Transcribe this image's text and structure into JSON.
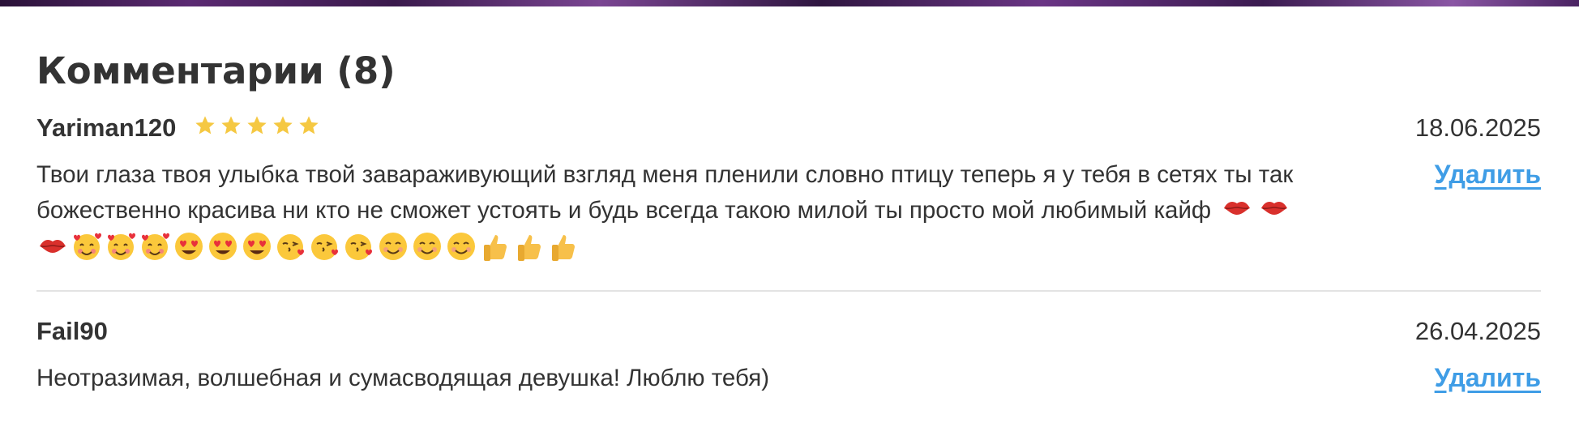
{
  "section": {
    "title": "Комментарии (8)"
  },
  "colors": {
    "accent_link": "#3f9de6",
    "star": "#f5c842",
    "text": "#333333",
    "divider": "#e3e3e3"
  },
  "comments": [
    {
      "author": "Yariman120",
      "rating": 5,
      "date": "18.06.2025",
      "text": "Твои глаза твоя улыбка твой завараживующий взгляд меня пленили словно птицу теперь я у тебя в сетях ты так божественно красива ни кто не сможет устоять и будь всегда такою милой ты просто мой любимый кайф",
      "emojis": [
        "kiss-lips",
        "kiss-lips",
        "kiss-lips",
        "smiling-face-with-hearts",
        "smiling-face-with-hearts",
        "smiling-face-with-hearts",
        "heart-eyes",
        "heart-eyes",
        "heart-eyes",
        "face-blowing-kiss",
        "face-blowing-kiss",
        "face-blowing-kiss",
        "smiling-face",
        "smiling-face",
        "smiling-face",
        "thumbs-up",
        "thumbs-up",
        "thumbs-up"
      ],
      "delete_label": "Удалить"
    },
    {
      "author": "Fail90",
      "rating": null,
      "date": "26.04.2025",
      "text": "Неотразимая, волшебная и сумасводящая девушка! Люблю тебя)",
      "emojis": [],
      "delete_label": "Удалить"
    }
  ]
}
